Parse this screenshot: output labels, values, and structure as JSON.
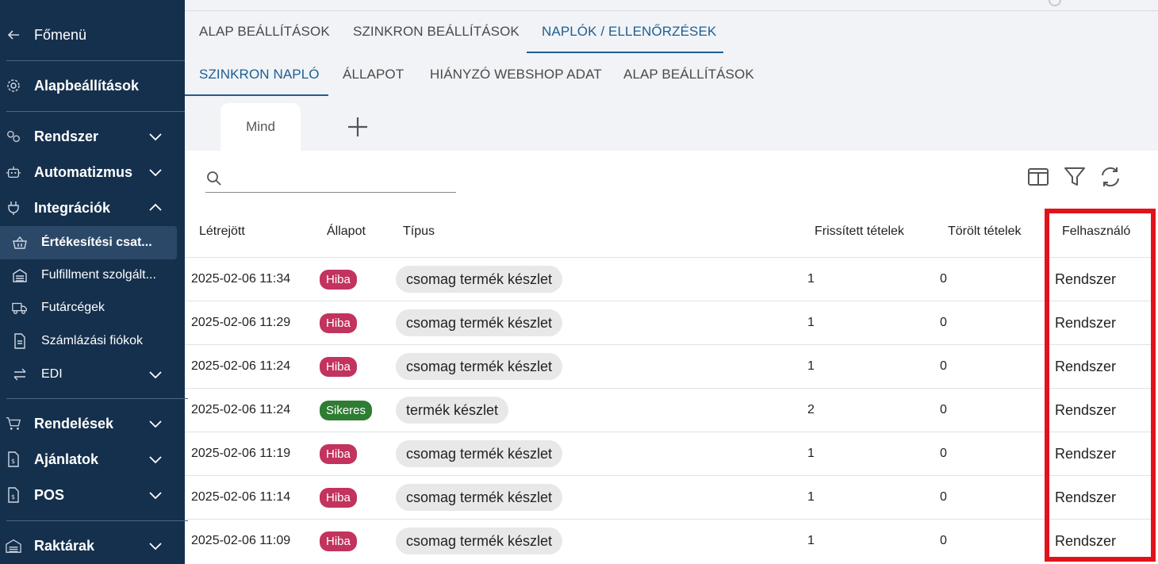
{
  "sidebar": {
    "back": "Főmenü",
    "items": [
      {
        "label": "Alapbeállítások"
      },
      {
        "label": "Rendszer"
      },
      {
        "label": "Automatizmus"
      },
      {
        "label": "Integrációk"
      },
      {
        "label": "Értékesítési csat..."
      },
      {
        "label": "Fulfillment szolgált..."
      },
      {
        "label": "Futárcégek"
      },
      {
        "label": "Számlázási fiókok"
      },
      {
        "label": "EDI"
      },
      {
        "label": "Rendelések"
      },
      {
        "label": "Ajánlatok"
      },
      {
        "label": "POS"
      },
      {
        "label": "Raktárak"
      }
    ]
  },
  "tabs": {
    "main": [
      "ALAP BEÁLLÍTÁSOK",
      "SZINKRON BEÁLLÍTÁSOK",
      "NAPLÓK / ELLENŐRZÉSEK"
    ],
    "sub": [
      "SZINKRON NAPLÓ",
      "ÁLLAPOT",
      "HIÁNYZÓ WEBSHOP ADAT",
      "ALAP BEÁLLÍTÁSOK"
    ],
    "active_main": "NAPLÓK / ELLENŐRZÉSEK",
    "active_sub": "SZINKRON NAPLÓ"
  },
  "views": {
    "active": "Mind"
  },
  "search": {
    "placeholder": ""
  },
  "table": {
    "headers": [
      "Létrejött",
      "Állapot",
      "Típus",
      "Frissített tételek",
      "Törölt tételek",
      "Felhasználó"
    ],
    "rows": [
      {
        "created": "2025-02-06 11:34",
        "status": "Hiba",
        "type": "csomag termék készlet",
        "updated": "1",
        "deleted": "0",
        "user": "Rendszer"
      },
      {
        "created": "2025-02-06 11:29",
        "status": "Hiba",
        "type": "csomag termék készlet",
        "updated": "1",
        "deleted": "0",
        "user": "Rendszer"
      },
      {
        "created": "2025-02-06 11:24",
        "status": "Hiba",
        "type": "csomag termék készlet",
        "updated": "1",
        "deleted": "0",
        "user": "Rendszer"
      },
      {
        "created": "2025-02-06 11:24",
        "status": "Sikeres",
        "type": "termék készlet",
        "updated": "2",
        "deleted": "0",
        "user": "Rendszer"
      },
      {
        "created": "2025-02-06 11:19",
        "status": "Hiba",
        "type": "csomag termék készlet",
        "updated": "1",
        "deleted": "0",
        "user": "Rendszer"
      },
      {
        "created": "2025-02-06 11:14",
        "status": "Hiba",
        "type": "csomag termék készlet",
        "updated": "1",
        "deleted": "0",
        "user": "Rendszer"
      },
      {
        "created": "2025-02-06 11:09",
        "status": "Hiba",
        "type": "csomag termék készlet",
        "updated": "1",
        "deleted": "0",
        "user": "Rendszer"
      }
    ]
  },
  "colors": {
    "sidebar_bg": "#15304d",
    "accent": "#1d5e93",
    "error_badge": "#c2335d",
    "success_badge": "#2e7d32",
    "highlight_box": "#e0131b"
  }
}
